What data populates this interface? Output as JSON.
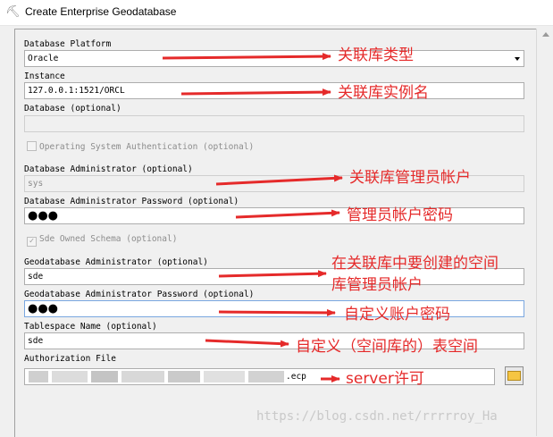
{
  "window": {
    "title": "Create Enterprise Geodatabase"
  },
  "fields": {
    "platform": {
      "label": "Database Platform",
      "value": "Oracle"
    },
    "instance": {
      "label": "Instance",
      "value": "127.0.0.1:1521/ORCL"
    },
    "database": {
      "label": "Database (optional)",
      "value": ""
    },
    "os_auth": {
      "label": "Operating System Authentication (optional)",
      "checked": false
    },
    "db_admin": {
      "label": "Database Administrator (optional)",
      "value": "sys"
    },
    "db_admin_password": {
      "label": "Database Administrator Password (optional)",
      "value": "●●●"
    },
    "sde_schema": {
      "label": "Sde Owned Schema (optional)",
      "checked": true
    },
    "gdb_admin": {
      "label": "Geodatabase Administrator (optional)",
      "value": "sde"
    },
    "gdb_admin_password": {
      "label": "Geodatabase Administrator Password (optional)",
      "value": "●●●"
    },
    "tablespace": {
      "label": "Tablespace Name (optional)",
      "value": "sde"
    },
    "auth_file": {
      "label": "Authorization File",
      "value": ".ecp"
    }
  },
  "annotations": {
    "platform": "关联库类型",
    "instance": "关联库实例名",
    "db_admin": "关联库管理员帐户",
    "db_admin_password": "管理员帐户密码",
    "gdb_admin_line1": "在关联库中要创建的空间",
    "gdb_admin_line2": "库管理员帐户",
    "gdb_admin_password": "自定义账户密码",
    "tablespace": "自定义（空间库的）表空间",
    "auth_file": "server许可"
  },
  "watermark": "https://blog.csdn.net/rrrrroy_Ha",
  "colors": {
    "annotation": "#e52a2a",
    "panel": "#f0f0f0"
  },
  "icons": {
    "title": "arcgis-tool-icon",
    "browse": "open-folder-icon"
  }
}
